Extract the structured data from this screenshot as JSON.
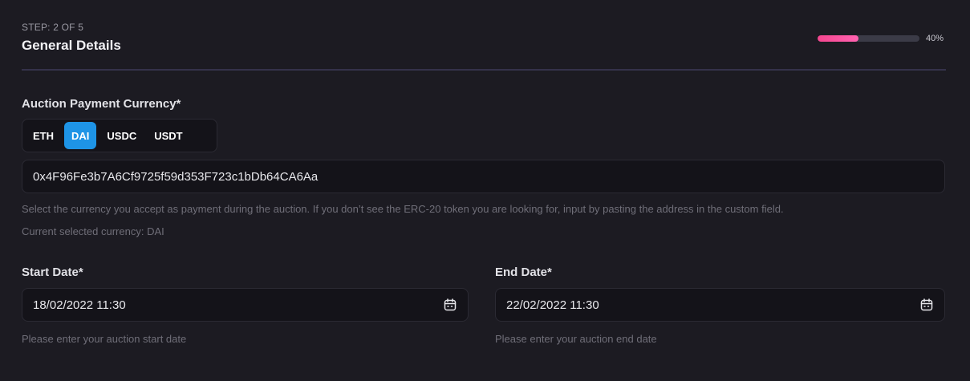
{
  "header": {
    "step": "STEP: 2 OF 5",
    "title": "General Details",
    "progress_percent": 40,
    "progress_text": "40%",
    "progress_color": "#f5468f"
  },
  "currency": {
    "label": "Auction Payment Currency*",
    "options": [
      "ETH",
      "DAI",
      "USDC",
      "USDT"
    ],
    "selected": "DAI",
    "accent": "#1e94e6",
    "address_value": "0x4F96Fe3b7A6Cf9725f59d353F723c1bDb64CA6Aa",
    "helper": "Select the currency you accept as payment during the auction. If you don’t see the ERC-20 token you are looking for, input by pasting the address in the custom field.",
    "current": "Current selected currency: DAI"
  },
  "start_date": {
    "label": "Start Date*",
    "value": "18/02/2022 11:30",
    "helper": "Please enter your auction start date",
    "icon": "calendar-icon"
  },
  "end_date": {
    "label": "End Date*",
    "value": "22/02/2022 11:30",
    "helper": "Please enter your auction end date",
    "icon": "calendar-icon"
  }
}
